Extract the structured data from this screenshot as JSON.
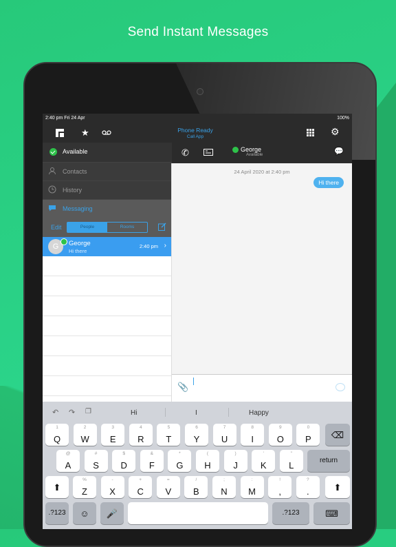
{
  "headline": "Send Instant Messages",
  "status": {
    "time_date": "2:40 pm   Fri 24 Apr",
    "battery": "100%"
  },
  "nav": {
    "title": "Phone Ready",
    "subtitle": "Call App"
  },
  "sidebar": {
    "presence": "Available",
    "items": [
      {
        "label": "Contacts"
      },
      {
        "label": "History"
      },
      {
        "label": "Messaging"
      }
    ],
    "edit": "Edit",
    "segments": [
      "People",
      "Rooms"
    ]
  },
  "conversation": {
    "avatar_letter": "G",
    "name": "George",
    "preview": "Hi there",
    "time": "2:40 pm"
  },
  "chat": {
    "contact": "George",
    "contact_status": "Available",
    "date": "24 April 2020 at 2:40 pm",
    "message": "Hi there"
  },
  "keyboard": {
    "suggestions": [
      "Hi",
      "I",
      "Happy"
    ],
    "row1": [
      [
        "1",
        "Q"
      ],
      [
        "2",
        "W"
      ],
      [
        "3",
        "E"
      ],
      [
        "4",
        "R"
      ],
      [
        "5",
        "T"
      ],
      [
        "6",
        "Y"
      ],
      [
        "7",
        "U"
      ],
      [
        "8",
        "I"
      ],
      [
        "9",
        "O"
      ],
      [
        "0",
        "P"
      ]
    ],
    "row2": [
      [
        "@",
        "A"
      ],
      [
        "#",
        "S"
      ],
      [
        "$",
        "D"
      ],
      [
        "&",
        "F"
      ],
      [
        "*",
        "G"
      ],
      [
        "(",
        "H"
      ],
      [
        ")",
        "J"
      ],
      [
        "'",
        "K"
      ],
      [
        "\"",
        "L"
      ]
    ],
    "row3": [
      [
        "%",
        "Z"
      ],
      [
        "-",
        "X"
      ],
      [
        "+",
        "C"
      ],
      [
        "=",
        "V"
      ],
      [
        "/",
        "B"
      ],
      [
        ";",
        "N"
      ],
      [
        ":",
        "M"
      ],
      [
        "!",
        ","
      ],
      [
        "?",
        "."
      ]
    ],
    "return_label": "return",
    "numbers_label": ".?123"
  }
}
